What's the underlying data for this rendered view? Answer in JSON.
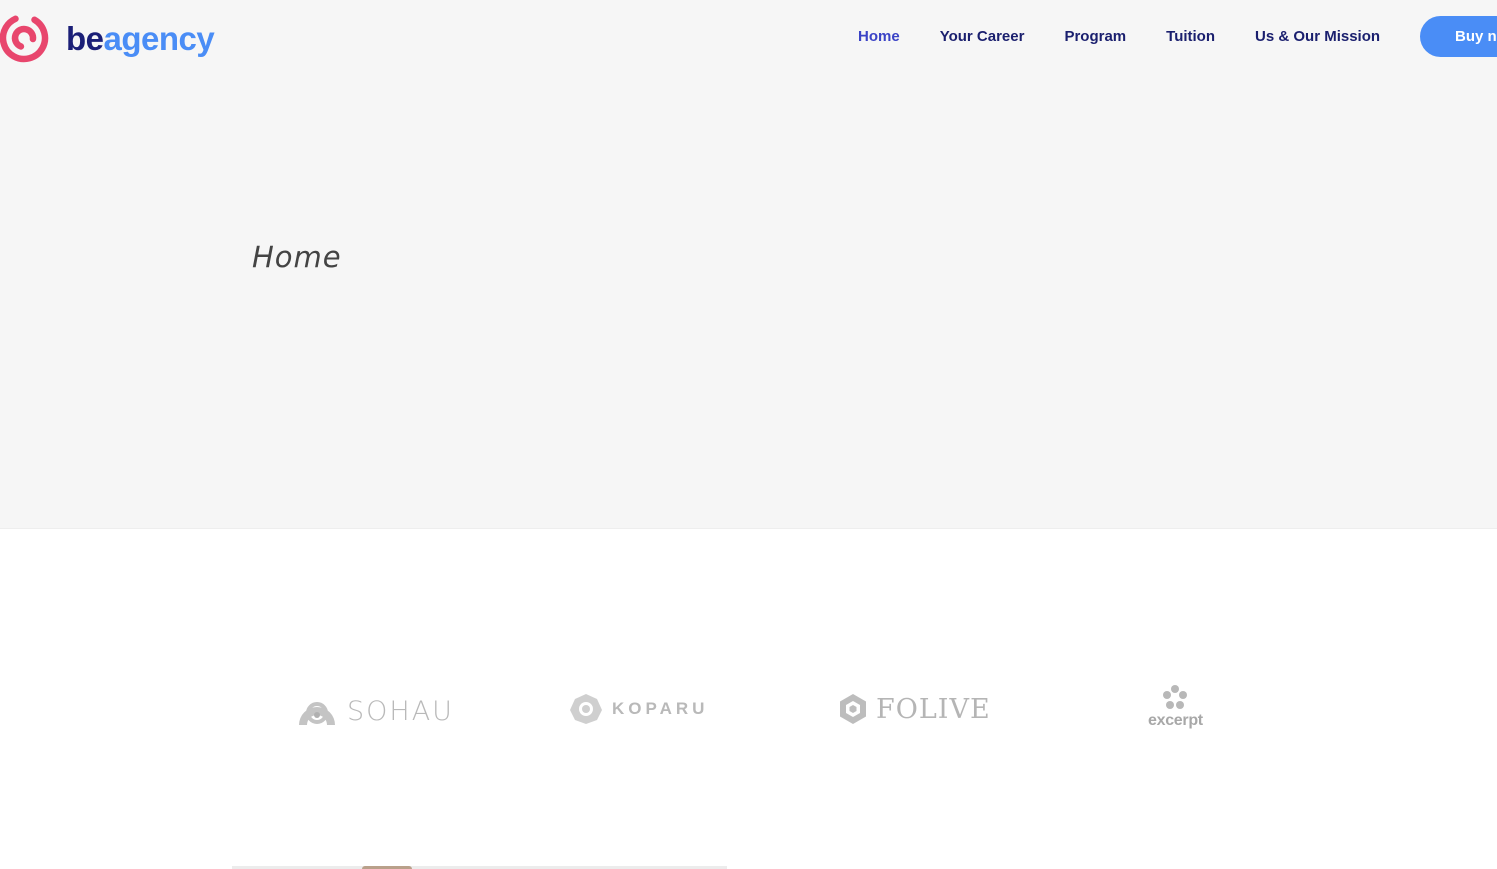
{
  "brand": {
    "logo_be": "be",
    "logo_agency": "agency",
    "colors": {
      "navy": "#1b1f77",
      "blue": "#4a8df6",
      "pink": "#e8466d",
      "active_nav": "#3b43c6"
    }
  },
  "nav": {
    "items": [
      {
        "label": "Home",
        "active": true
      },
      {
        "label": "Your Career",
        "active": false
      },
      {
        "label": "Program",
        "active": false
      },
      {
        "label": "Tuition",
        "active": false
      },
      {
        "label": "Us & Our Mission",
        "active": false
      }
    ],
    "cta_label": "Buy n"
  },
  "hero": {
    "title": "Home"
  },
  "clients": [
    {
      "name": "SOHAU",
      "icon": "sohau-logo-icon"
    },
    {
      "name": "KOPARU",
      "icon": "koparu-logo-icon"
    },
    {
      "name": "FOLIVE",
      "icon": "folive-logo-icon"
    },
    {
      "name": "excerpt",
      "icon": "excerpt-logo-icon"
    }
  ]
}
